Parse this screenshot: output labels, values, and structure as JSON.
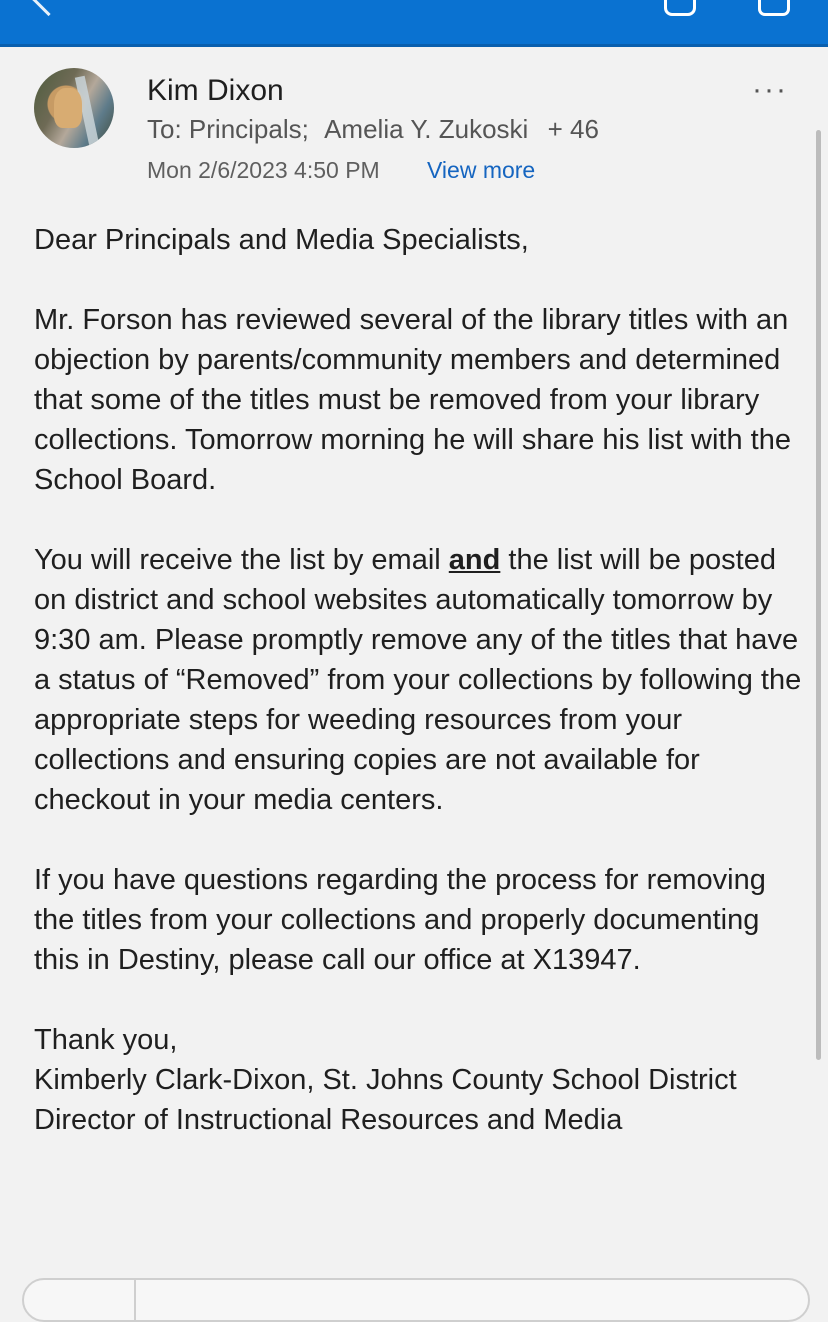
{
  "email": {
    "sender": "Kim Dixon",
    "to_label": "To:",
    "recipient1": "Principals;",
    "recipient2": "Amelia Y. Zukoski",
    "more_recipients": "+ 46",
    "date": "Mon 2/6/2023 4:50 PM",
    "view_more": "View more",
    "more_options": "···",
    "greeting": "Dear Principals and Media Specialists,",
    "para1": "Mr. Forson has reviewed several of the library titles with an objection by parents/community members and determined that some of the titles must be removed from your library collections.  Tomorrow morning he will share his list with the School Board.",
    "para2_a": "You will receive the list by email ",
    "para2_and": "and",
    "para2_b": " the list will be posted on district and school websites automatically tomorrow by 9:30 am.  Please promptly remove any of the titles that have a status of “Removed” from your collections by following the appropriate steps for weeding resources from your collections and ensuring copies are not available for checkout in your media centers.",
    "para3": "If you have questions regarding the process for removing the titles from your collections and properly documenting this in Destiny, please call our office at X13947.",
    "closing": "Thank you,",
    "sig_name": "Kimberly Clark-Dixon, St. Johns County School District",
    "sig_title": "Director of Instructional Resources and Media"
  },
  "colors": {
    "topbar": "#0a72d1",
    "link": "#1565c0",
    "background": "#f2f2f2"
  },
  "icons": [
    "back-arrow-icon",
    "toolbar-icon",
    "toolbar-icon",
    "more-options-icon"
  ]
}
